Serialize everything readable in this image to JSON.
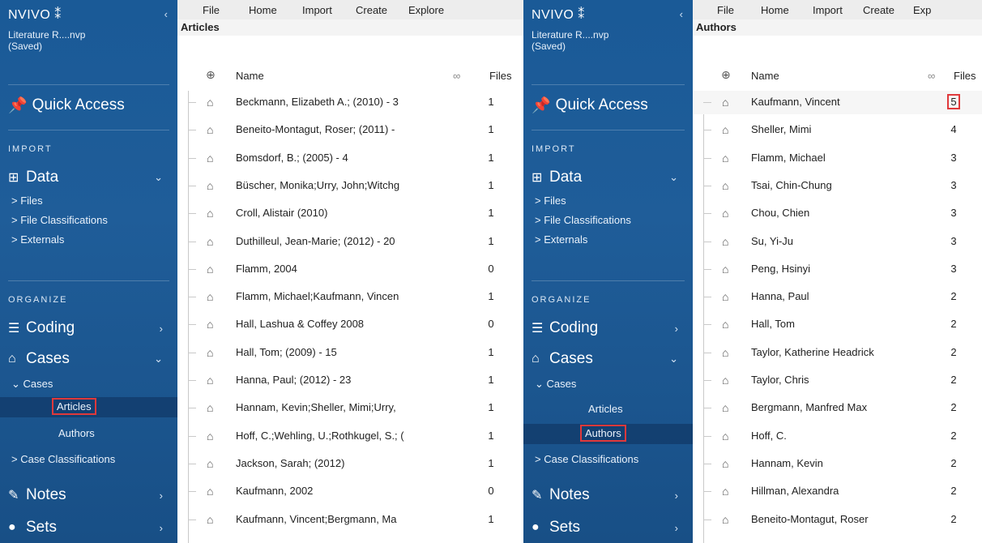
{
  "left": {
    "sidebar": {
      "brand": "NVIVO",
      "brand_mark": "⁑",
      "collapse_glyph": "‹",
      "project_name": "Literature R....nvp",
      "project_status": "(Saved)",
      "quick_access": "Quick Access",
      "import_label": "IMPORT",
      "data_label": "Data",
      "data_items": [
        "> Files",
        "> File Classifications",
        "> Externals"
      ],
      "organize_label": "ORGANIZE",
      "coding_label": "Coding",
      "cases_label": "Cases",
      "cases_sub": "Cases",
      "cases_children": [
        "Articles",
        "Authors"
      ],
      "case_classifications": "> Case Classifications",
      "notes_label": "Notes",
      "sets_label": "Sets"
    },
    "menu": [
      "File",
      "Home",
      "Import",
      "Create",
      "Explore"
    ],
    "breadcrumb": "Articles",
    "columns": {
      "name": "Name",
      "files": "Files"
    },
    "rows": [
      {
        "name": "Beckmann, Elizabeth A.; (2010) - 3",
        "files": "1"
      },
      {
        "name": "Beneito-Montagut, Roser; (2011) -",
        "files": "1"
      },
      {
        "name": "Bomsdorf, B.; (2005) - 4",
        "files": "1"
      },
      {
        "name": "Büscher, Monika;Urry, John;Witchg",
        "files": "1"
      },
      {
        "name": "Croll, Alistair (2010)",
        "files": "1"
      },
      {
        "name": "Duthilleul, Jean-Marie; (2012) - 20",
        "files": "1"
      },
      {
        "name": "Flamm, 2004",
        "files": "0"
      },
      {
        "name": "Flamm, Michael;Kaufmann, Vincen",
        "files": "1"
      },
      {
        "name": "Hall, Lashua & Coffey 2008",
        "files": "0"
      },
      {
        "name": "Hall, Tom; (2009) - 15",
        "files": "1"
      },
      {
        "name": "Hanna, Paul; (2012) - 23",
        "files": "1"
      },
      {
        "name": "Hannam, Kevin;Sheller, Mimi;Urry,",
        "files": "1"
      },
      {
        "name": "Hoff, C.;Wehling, U.;Rothkugel, S.; (",
        "files": "1"
      },
      {
        "name": "Jackson, Sarah; (2012)",
        "files": "1"
      },
      {
        "name": "Kaufmann, 2002",
        "files": "0"
      },
      {
        "name": "Kaufmann, Vincent;Bergmann, Ma",
        "files": "1"
      }
    ]
  },
  "right": {
    "sidebar": {
      "brand": "NVIVO",
      "brand_mark": "⁑",
      "collapse_glyph": "‹",
      "project_name": "Literature R....nvp",
      "project_status": "(Saved)",
      "quick_access": "Quick Access",
      "import_label": "IMPORT",
      "data_label": "Data",
      "data_items": [
        "> Files",
        "> File Classifications",
        "> Externals"
      ],
      "organize_label": "ORGANIZE",
      "coding_label": "Coding",
      "cases_label": "Cases",
      "cases_sub": "Cases",
      "cases_children": [
        "Articles",
        "Authors"
      ],
      "case_classifications": "> Case Classifications",
      "notes_label": "Notes",
      "sets_label": "Sets"
    },
    "menu": [
      "File",
      "Home",
      "Import",
      "Create",
      "Exp"
    ],
    "breadcrumb": "Authors",
    "columns": {
      "name": "Name",
      "files": "Files"
    },
    "rows": [
      {
        "name": "Kaufmann, Vincent",
        "files": "5"
      },
      {
        "name": "Sheller, Mimi",
        "files": "4"
      },
      {
        "name": "Flamm, Michael",
        "files": "3"
      },
      {
        "name": "Tsai, Chin-Chung",
        "files": "3"
      },
      {
        "name": "Chou, Chien",
        "files": "3"
      },
      {
        "name": "Su, Yi-Ju",
        "files": "3"
      },
      {
        "name": "Peng, Hsinyi",
        "files": "3"
      },
      {
        "name": "Hanna, Paul",
        "files": "2"
      },
      {
        "name": "Hall, Tom",
        "files": "2"
      },
      {
        "name": "Taylor, Katherine Headrick",
        "files": "2"
      },
      {
        "name": "Taylor, Chris",
        "files": "2"
      },
      {
        "name": "Bergmann, Manfred Max",
        "files": "2"
      },
      {
        "name": "Hoff, C.",
        "files": "2"
      },
      {
        "name": "Hannam, Kevin",
        "files": "2"
      },
      {
        "name": "Hillman, Alexandra",
        "files": "2"
      },
      {
        "name": "Beneito-Montagut, Roser",
        "files": "2"
      }
    ]
  },
  "colors": {
    "sidebar": "#1a5a97",
    "highlight": "#e0393b",
    "menubar": "#ededed"
  }
}
